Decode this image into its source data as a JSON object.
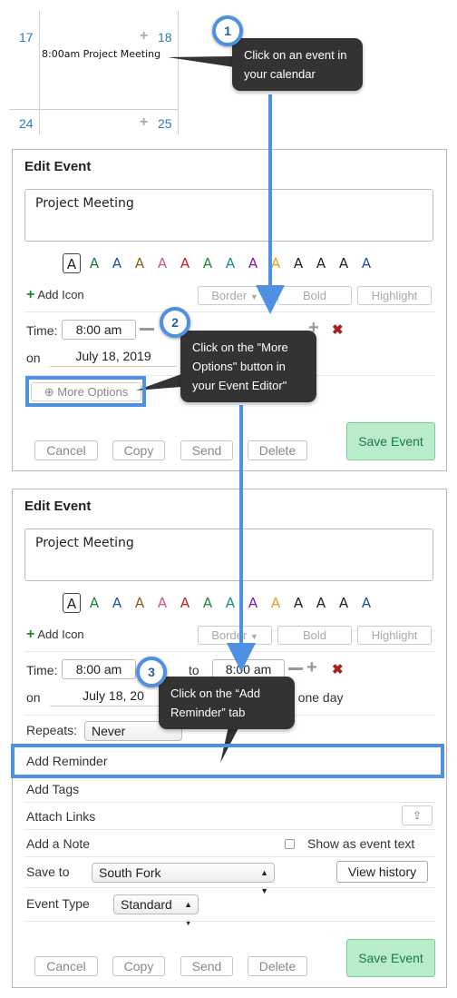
{
  "calendar": {
    "days": [
      "17",
      "18",
      "24",
      "25"
    ],
    "event": "8:00am Project Meeting"
  },
  "editor1": {
    "title": "Edit Event",
    "event_text": "Project Meeting",
    "swatch_letter": "A",
    "swatch_colors": [
      "#222222",
      "#1a7a3a",
      "#1f4fa0",
      "#8a5a1a",
      "#d6508a",
      "#c02020",
      "#1a8a3a",
      "#1a8a8a",
      "#7a1aa0",
      "#e0a020",
      "#222222",
      "#222222",
      "#222222",
      "#1f4fa0"
    ],
    "add_icon": "Add Icon",
    "border_btn": "Border",
    "bold_btn": "Bold",
    "highlight_btn": "Highlight",
    "time_label": "Time:",
    "start_time": "8:00 am",
    "on_label": "on",
    "date": "July 18, 2019",
    "more_options": "More Options",
    "cancel": "Cancel",
    "copy": "Copy",
    "send": "Send",
    "delete": "Delete",
    "save": "Save Event"
  },
  "editor2": {
    "title": "Edit Event",
    "event_text": "Project Meeting",
    "add_icon": "Add Icon",
    "border_btn": "Border",
    "bold_btn": "Bold",
    "highlight_btn": "Highlight",
    "time_label": "Time:",
    "start_time": "8:00 am",
    "to_label": "to",
    "end_time": "8:00 am",
    "on_label": "on",
    "date": "July 18, 2019",
    "date_visible": "July 18, 20",
    "one_day": "n one day",
    "repeats_label": "Repeats:",
    "repeats_value": "Never",
    "add_reminder": "Add Reminder",
    "add_tags": "Add Tags",
    "attach_links": "Attach Links",
    "add_note": "Add a Note",
    "show_as_text": "Show as event text",
    "save_to_label": "Save to",
    "save_to_value": "South Fork",
    "view_history": "View history",
    "event_type_label": "Event Type",
    "event_type_value": "Standard",
    "cancel": "Cancel",
    "copy": "Copy",
    "send": "Send",
    "delete": "Delete",
    "save": "Save Event"
  },
  "steps": [
    {
      "number": "1",
      "text": "Click on an event in your calendar"
    },
    {
      "number": "2",
      "text": "Click on the \"More Options\" button in your Event Editor\""
    },
    {
      "number": "3",
      "text": "Click on the “Add Reminder” tab"
    }
  ],
  "colors": {
    "accent": "#4f90e2",
    "callout_bg": "#333333",
    "save_bg": "#b9ecca",
    "calendar_day": "#2a7db8"
  }
}
